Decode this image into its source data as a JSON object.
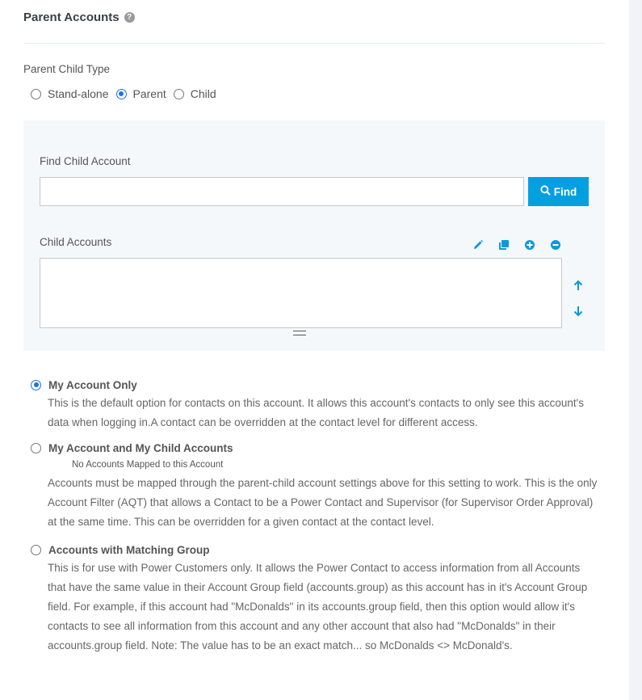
{
  "header": {
    "title": "Parent Accounts",
    "help_icon": "question-circle-icon"
  },
  "parent_child_type": {
    "label": "Parent Child Type",
    "options": [
      {
        "label": "Stand-alone",
        "checked": false
      },
      {
        "label": "Parent",
        "checked": true
      },
      {
        "label": "Child",
        "checked": false
      }
    ]
  },
  "find_child": {
    "label": "Find Child Account",
    "input_value": "",
    "input_placeholder": "",
    "button_label": "Find",
    "button_icon": "search-icon"
  },
  "child_accounts": {
    "label": "Child Accounts",
    "toolbar_icons": [
      "pencil-icon",
      "copy-icon",
      "plus-circle-icon",
      "minus-circle-icon"
    ],
    "items": [],
    "move_icons": [
      "arrow-up-icon",
      "arrow-down-icon"
    ]
  },
  "access_options": [
    {
      "title": "My Account Only",
      "checked": true,
      "note": "",
      "description": "This is the default option for contacts on this account. It allows this account's contacts to only see this account's data when logging in.A contact can be overridden at the contact level for different access."
    },
    {
      "title": "My Account and My Child Accounts",
      "checked": false,
      "note": "No Accounts Mapped to this Account",
      "description": "Accounts must be mapped through the parent-child account settings above for this setting to work. This is the only Account Filter (AQT) that allows a Contact to be a Power Contact and Supervisor (for Supervisor Order Approval) at the same time. This can be overridden for a given contact at the contact level."
    },
    {
      "title": "Accounts with Matching Group",
      "checked": false,
      "note": "",
      "description": "This is for use with Power Customers only. It allows the Power Contact to access information from all Accounts that have the same value in their Account Group field (accounts.group) as this account has in it's Account Group field. For example, if this account had \"McDonalds\" in its accounts.group field, then this option would allow it's contacts to see all information from this account and any other account that also had \"McDonalds\" in their accounts.group field. Note: The value has to be an exact match... so McDonalds <> McDonald's."
    }
  ],
  "colors": {
    "accent": "#03a0e0",
    "radio_checked": "#1a73e8",
    "panel_bg": "#f5f8fb"
  }
}
